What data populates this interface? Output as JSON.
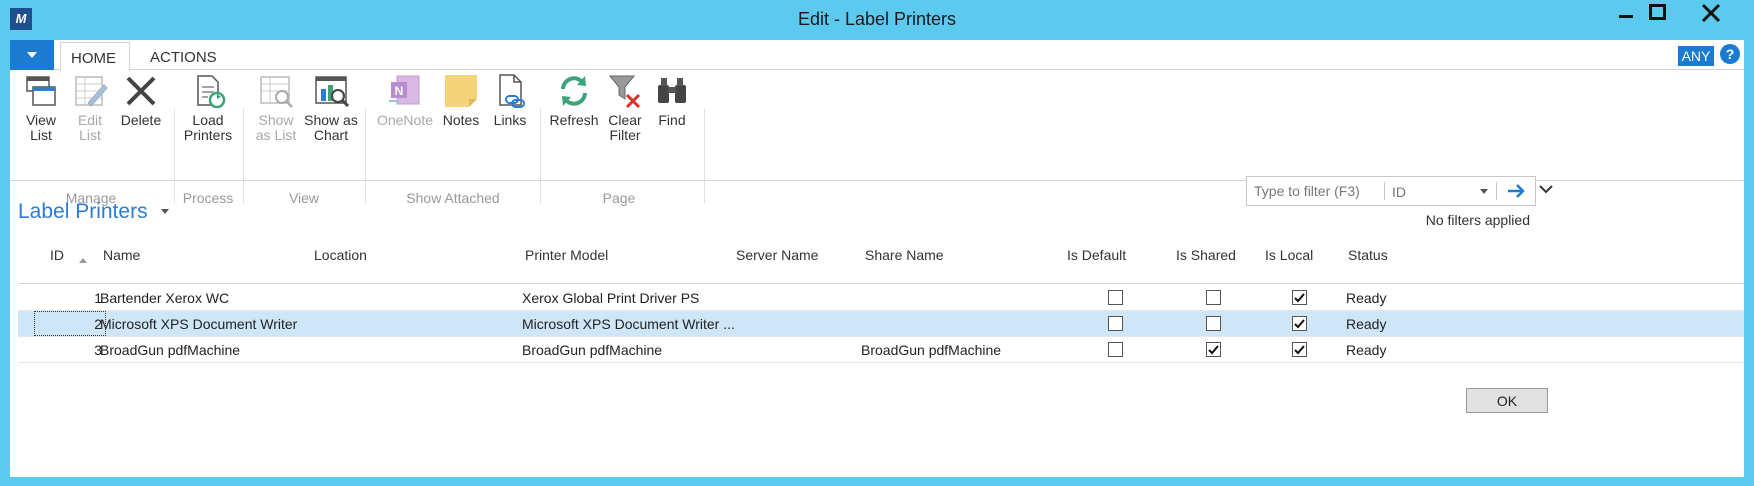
{
  "window": {
    "title": "Edit - Label Printers",
    "logo_text": "M"
  },
  "tabs": {
    "home": "HOME",
    "actions": "ACTIONS",
    "language": "ANY",
    "help": "?"
  },
  "ribbon": {
    "groups": {
      "manage": "Manage",
      "process": "Process",
      "view": "View",
      "show_attached": "Show Attached",
      "page": "Page"
    },
    "buttons": {
      "view_list": [
        "View",
        "List"
      ],
      "edit_list": [
        "Edit",
        "List"
      ],
      "delete": [
        "Delete"
      ],
      "load_printers": [
        "Load",
        "Printers"
      ],
      "show_as_list": [
        "Show",
        "as List"
      ],
      "show_as_chart": [
        "Show as",
        "Chart"
      ],
      "onenote": [
        "OneNote"
      ],
      "notes": [
        "Notes"
      ],
      "links": [
        "Links"
      ],
      "refresh": [
        "Refresh"
      ],
      "clear_filter": [
        "Clear",
        "Filter"
      ],
      "find": [
        "Find"
      ]
    }
  },
  "page": {
    "title": "Label Printers",
    "filter_placeholder": "Type to filter (F3)",
    "filter_field": "ID",
    "filter_status": "No filters applied"
  },
  "table": {
    "columns": {
      "id": "ID",
      "name": "Name",
      "location": "Location",
      "printer_model": "Printer Model",
      "server_name": "Server Name",
      "share_name": "Share Name",
      "is_default": "Is Default",
      "is_shared": "Is Shared",
      "is_local": "Is Local",
      "status": "Status"
    },
    "rows": [
      {
        "id": "1",
        "name": "Bartender Xerox WC",
        "location": "",
        "printer_model": "Xerox Global Print Driver PS",
        "server_name": "",
        "share_name": "",
        "is_default": false,
        "is_shared": false,
        "is_local": true,
        "status": "Ready"
      },
      {
        "id": "2",
        "name": "Microsoft XPS Document Writer",
        "location": "",
        "printer_model": "Microsoft XPS Document Writer ...",
        "server_name": "",
        "share_name": "",
        "is_default": false,
        "is_shared": false,
        "is_local": true,
        "status": "Ready"
      },
      {
        "id": "3",
        "name": "BroadGun pdfMachine",
        "location": "",
        "printer_model": "BroadGun pdfMachine",
        "server_name": "",
        "share_name": "BroadGun pdfMachine",
        "is_default": false,
        "is_shared": true,
        "is_local": true,
        "status": "Ready"
      }
    ],
    "selected_row": 1
  },
  "footer": {
    "ok_label": "OK"
  },
  "colors": {
    "titlebar": "#5cc9ee",
    "accent": "#1a7bd0",
    "page_title": "#2b7cd3",
    "selected_row": "#cfe6f8"
  }
}
